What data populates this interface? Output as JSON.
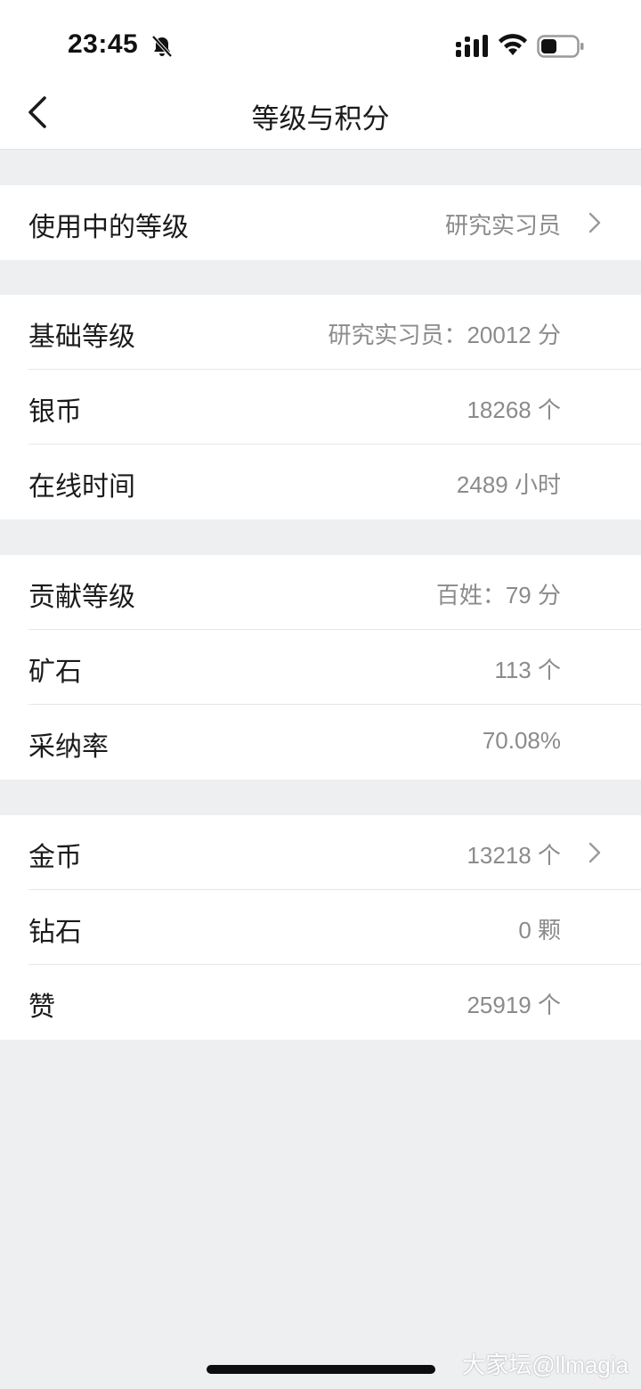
{
  "status_bar": {
    "time": "23:45",
    "icons": [
      "bell-slash-icon",
      "signal-icon",
      "wifi-icon",
      "battery-icon"
    ]
  },
  "nav": {
    "title": "等级与积分",
    "back_icon": "chevron-left-icon"
  },
  "sections": [
    {
      "rows": [
        {
          "label": "使用中的等级",
          "value": "研究实习员",
          "has_chevron": true
        }
      ]
    },
    {
      "rows": [
        {
          "label": "基础等级",
          "value": "研究实习员：20012 分"
        },
        {
          "label": "银币",
          "value": "18268 个"
        },
        {
          "label": "在线时间",
          "value": "2489 小时"
        }
      ]
    },
    {
      "rows": [
        {
          "label": "贡献等级",
          "value": "百姓：79 分"
        },
        {
          "label": "矿石",
          "value": "113 个"
        },
        {
          "label": "采纳率",
          "value": "70.08%"
        }
      ]
    },
    {
      "rows": [
        {
          "label": "金币",
          "value": "13218 个",
          "has_chevron": true
        },
        {
          "label": "钻石",
          "value": "0 颗"
        },
        {
          "label": "赞",
          "value": "25919 个"
        }
      ]
    }
  ],
  "watermark": "大家坛@llmagia",
  "colors": {
    "background": "#eeeff1",
    "card": "#ffffff",
    "label_text": "#1b1b1b",
    "value_text": "#8b8b8d",
    "divider": "#e6e6e8"
  }
}
